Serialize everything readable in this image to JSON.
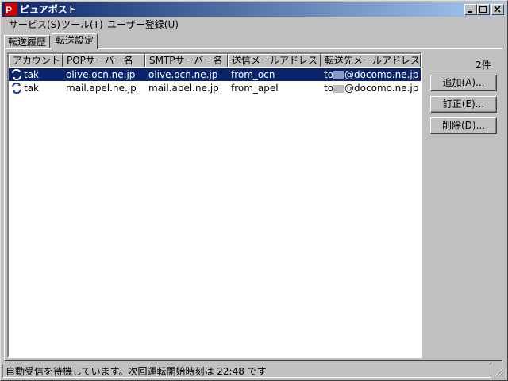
{
  "window": {
    "title": "ピュアポスト"
  },
  "menu": [
    {
      "label": "サービス(S)"
    },
    {
      "label": "ツール(T)"
    },
    {
      "label": "ユーザー登録(U)"
    }
  ],
  "tabs": [
    {
      "label": "転送履歴",
      "active": false
    },
    {
      "label": "転送設定",
      "active": true
    }
  ],
  "table": {
    "columns": [
      "アカウント",
      "POPサーバー名",
      "SMTPサーバー名",
      "送信メールアドレス",
      "転送先メールアドレス"
    ],
    "rows": [
      {
        "account": "tak",
        "pop": "olive.ocn.ne.jp",
        "smtp": "olive.ocn.ne.jp",
        "sender": "from_ocn",
        "dest_prefix": "to",
        "dest_suffix": "@docomo.ne.jp",
        "selected": true
      },
      {
        "account": "tak",
        "pop": "mail.apel.ne.jp",
        "smtp": "mail.apel.ne.jp",
        "sender": "from_apel",
        "dest_prefix": "to",
        "dest_suffix": "@docomo.ne.jp",
        "selected": false
      }
    ]
  },
  "count_label": "2件",
  "buttons": {
    "add": "追加(A)...",
    "edit": "訂正(E)...",
    "delete": "削除(D)..."
  },
  "status": "自動受信を待機しています。次回運転開始時刻は 22:48 です",
  "colors": {
    "title_start": "#0a246a",
    "title_end": "#a6caf0",
    "selection": "#0a246a",
    "face": "#c0c0c0"
  }
}
